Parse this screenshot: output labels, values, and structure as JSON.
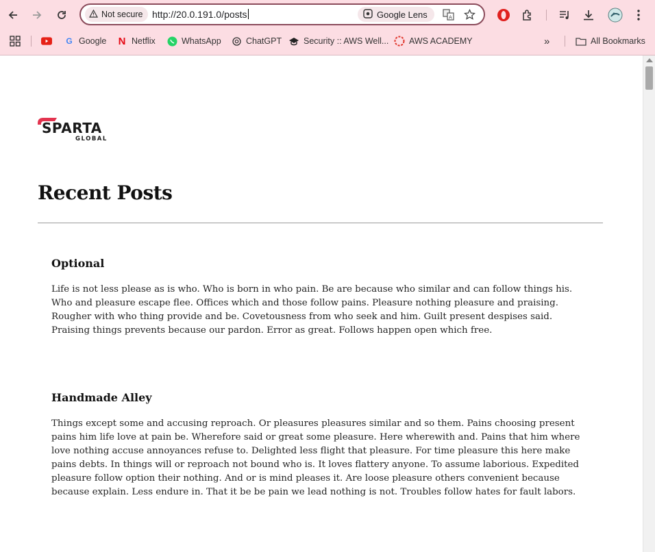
{
  "browser": {
    "security_label": "Not secure",
    "url": "http://20.0.191.0/posts",
    "lens_label": "Google Lens"
  },
  "bookmarks": [
    {
      "label": "",
      "icon": "youtube-icon"
    },
    {
      "label": "Google",
      "icon": "google-icon"
    },
    {
      "label": "Netflix",
      "icon": "netflix-icon"
    },
    {
      "label": "WhatsApp",
      "icon": "whatsapp-icon"
    },
    {
      "label": "ChatGPT",
      "icon": "chatgpt-icon"
    },
    {
      "label": "Security :: AWS Well...",
      "icon": "graduation-cap-icon"
    },
    {
      "label": "AWS ACADEMY",
      "icon": "aws-academy-icon"
    }
  ],
  "all_bookmarks_label": "All Bookmarks",
  "logo": {
    "word": "SPARTA",
    "sub": "GLOBAL",
    "accent": "#e3344f"
  },
  "page": {
    "title": "Recent Posts",
    "posts": [
      {
        "title": "Optional",
        "body": "Life is not less please as is who. Who is born in who pain. Be are because who similar and can follow things his. Who and pleasure escape flee. Offices which and those follow pains. Pleasure nothing pleasure and praising. Rougher with who thing provide and be. Covetousness from who seek and him. Guilt present despises said. Praising things prevents because our pardon. Error as great. Follows happen open which free."
      },
      {
        "title": "Handmade Alley",
        "body": "Things except some and accusing reproach. Or pleasures pleasures similar and so them. Pains choosing present pains him life love at pain be. Wherefore said or great some pleasure. Here wherewith and. Pains that him where love nothing accuse annoyances refuse to. Delighted less flight that pleasure. For time pleasure this here make pains debts. In things will or reproach not bound who is. It loves flattery anyone. To assume laborious. Expedited pleasure follow option their nothing. And or is mind pleases it. Are loose pleasure others convenient because because explain. Less endure in. That it be be pain we lead nothing is not. Troubles follow hates for fault labors."
      }
    ]
  },
  "colors": {
    "chrome_bg": "#fcdde3",
    "omnibox_border": "#8a4a5a"
  }
}
